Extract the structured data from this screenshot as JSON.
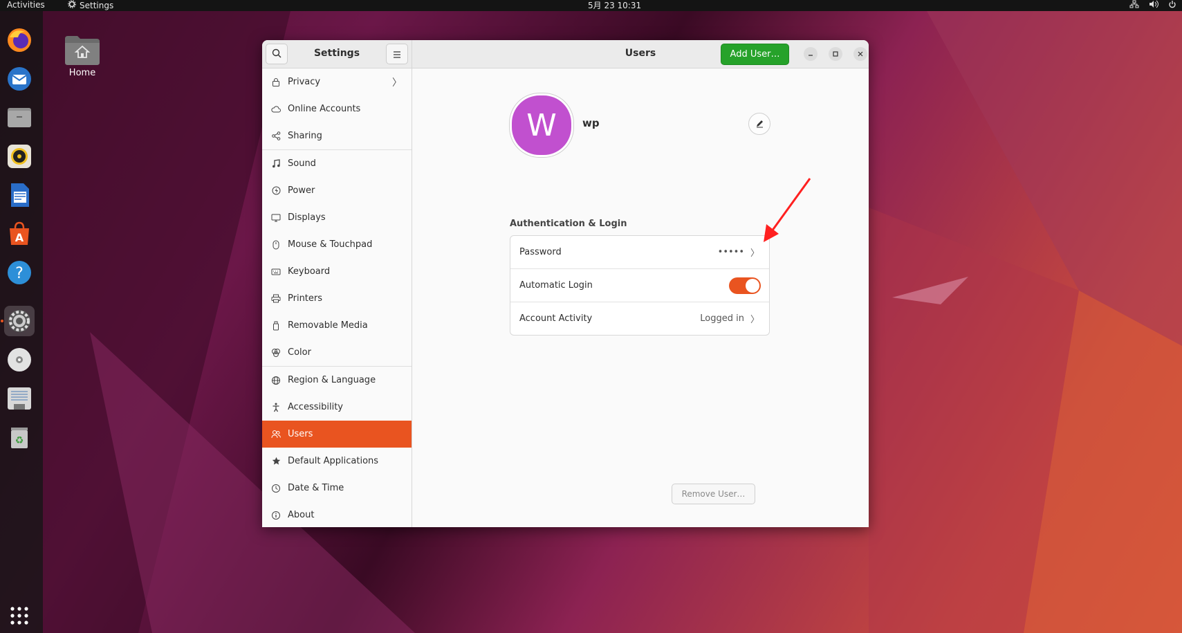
{
  "topbar": {
    "activities": "Activities",
    "app_name": "Settings",
    "clock": "5月 23  10:31"
  },
  "desktop": {
    "home_label": "Home"
  },
  "dock": {
    "apps": [
      "firefox",
      "thunderbird",
      "files",
      "rhythmbox",
      "libreoffice-writer",
      "app-center",
      "help",
      "settings",
      "disc",
      "text-editor",
      "trash",
      "show-apps"
    ],
    "active": "settings"
  },
  "window": {
    "sidebar_title": "Settings",
    "main_title": "Users",
    "add_user_label": "Add User…",
    "sidebar": {
      "items": [
        {
          "label": "Privacy",
          "icon": "lock-icon",
          "has_chevron": true
        },
        {
          "label": "Online Accounts",
          "icon": "cloud-icon"
        },
        {
          "label": "Sharing",
          "icon": "share-icon"
        },
        {
          "label": "Sound",
          "icon": "music-note-icon"
        },
        {
          "label": "Power",
          "icon": "power-icon"
        },
        {
          "label": "Displays",
          "icon": "display-icon"
        },
        {
          "label": "Mouse & Touchpad",
          "icon": "mouse-icon"
        },
        {
          "label": "Keyboard",
          "icon": "keyboard-icon"
        },
        {
          "label": "Printers",
          "icon": "printer-icon"
        },
        {
          "label": "Removable Media",
          "icon": "usb-icon"
        },
        {
          "label": "Color",
          "icon": "color-icon"
        },
        {
          "label": "Region & Language",
          "icon": "globe-icon"
        },
        {
          "label": "Accessibility",
          "icon": "accessibility-icon"
        },
        {
          "label": "Users",
          "icon": "users-icon",
          "selected": true
        },
        {
          "label": "Default Applications",
          "icon": "star-icon"
        },
        {
          "label": "Date & Time",
          "icon": "clock-icon"
        },
        {
          "label": "About",
          "icon": "info-icon"
        }
      ]
    },
    "user": {
      "avatar_letter": "W",
      "avatar_color": "#c150cf",
      "name": "wp"
    },
    "auth_section_label": "Authentication & Login",
    "rows": {
      "password": {
        "label": "Password",
        "value": "•••••"
      },
      "auto_login": {
        "label": "Automatic Login",
        "enabled": true
      },
      "account_activity": {
        "label": "Account Activity",
        "value": "Logged in"
      }
    },
    "remove_user_label": "Remove User…"
  },
  "colors": {
    "accent": "#e95420",
    "add_button": "#26a22a",
    "annotation_arrow": "#ff2020"
  }
}
